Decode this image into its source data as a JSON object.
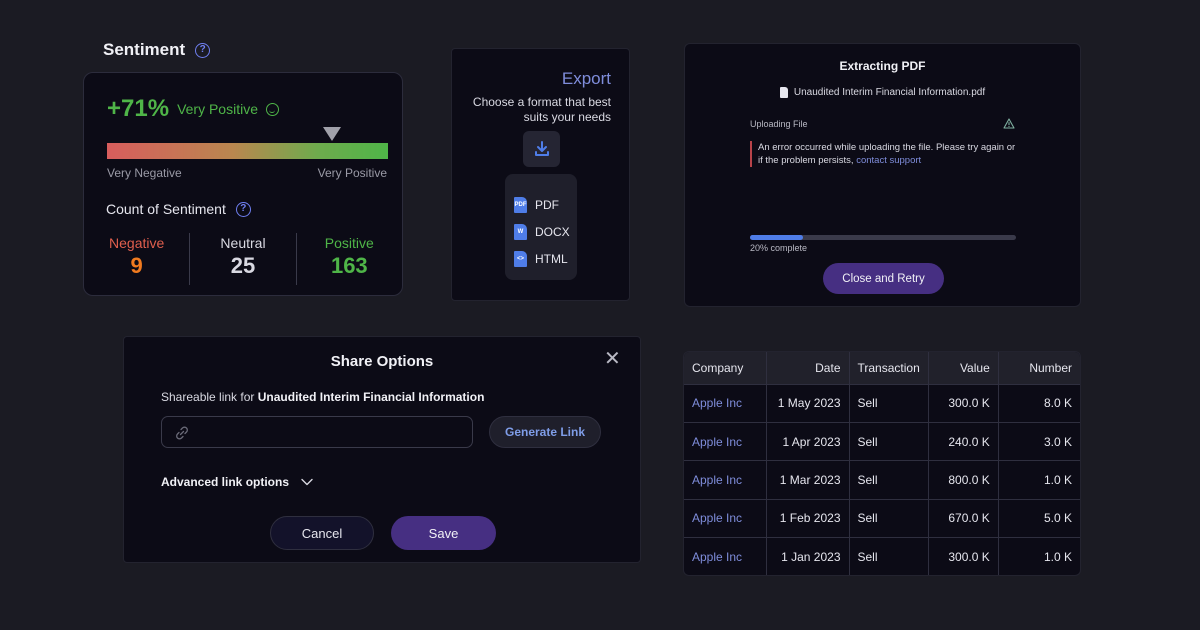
{
  "sentiment": {
    "title": "Sentiment",
    "percent": "+71%",
    "label": "Very Positive",
    "marker_position": 0.8,
    "bar_left_label": "Very Negative",
    "bar_right_label": "Very Positive",
    "count_title": "Count of Sentiment",
    "counts": [
      {
        "label": "Negative",
        "value": "9",
        "color": "#e05f4d"
      },
      {
        "label": "Neutral",
        "value": "25",
        "color": "#d9d9e2"
      },
      {
        "label": "Positive",
        "value": "163",
        "color": "#4fb548"
      }
    ]
  },
  "export": {
    "title": "Export",
    "subtitle": "Choose a format that best suits your needs",
    "formats": [
      {
        "label": "PDF",
        "icon": "pdf-file-icon"
      },
      {
        "label": "DOCX",
        "icon": "word-file-icon"
      },
      {
        "label": "HTML",
        "icon": "html-file-icon"
      }
    ]
  },
  "extracting": {
    "title": "Extracting PDF",
    "file_name": "Unaudited Interim Financial Information.pdf",
    "status": "Uploading File",
    "error_text": "An error occurred while uploading the file. Please try again or if the problem persists,",
    "error_link": "contact support",
    "progress": 0.2,
    "progress_label": "20% complete",
    "retry_label": "Close and Retry"
  },
  "share": {
    "title": "Share Options",
    "link_label_prefix": "Shareable link for",
    "link_label_doc": "Unaudited Interim Financial Information",
    "input_value": "",
    "generate_label": "Generate Link",
    "advanced_label": "Advanced link options",
    "cancel_label": "Cancel",
    "save_label": "Save"
  },
  "table": {
    "headers": [
      "Company",
      "Date",
      "Transaction",
      "Value",
      "Number"
    ],
    "rows": [
      [
        "Apple Inc",
        "1 May 2023",
        "Sell",
        "300.0 K",
        "8.0 K"
      ],
      [
        "Apple Inc",
        "1 Apr 2023",
        "Sell",
        "240.0 K",
        "3.0 K"
      ],
      [
        "Apple Inc",
        "1 Mar 2023",
        "Sell",
        "800.0 K",
        "1.0 K"
      ],
      [
        "Apple Inc",
        "1 Feb 2023",
        "Sell",
        "670.0 K",
        "5.0 K"
      ],
      [
        "Apple Inc",
        "1 Jan 2023",
        "Sell",
        "300.0 K",
        "1.0 K"
      ]
    ]
  },
  "colors": {
    "background": "#1b1b23",
    "card": "#0c0b16",
    "accent_purple": "#462f82",
    "link_blue": "#7f8ddb",
    "positive": "#4fb548",
    "negative": "#e05f4d"
  }
}
